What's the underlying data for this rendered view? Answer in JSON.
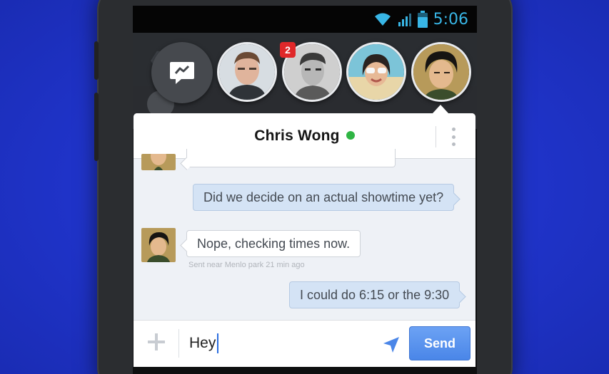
{
  "status_bar": {
    "time": "5:06",
    "wifi_icon": "wifi-icon",
    "signal_icon": "signal-icon",
    "battery_icon": "battery-icon"
  },
  "chat_heads": [
    {
      "name": "messenger",
      "icon": "messenger-icon"
    },
    {
      "name": "contact-1"
    },
    {
      "name": "contact-2",
      "badge": "2"
    },
    {
      "name": "contact-3"
    },
    {
      "name": "chris-wong",
      "active": true
    }
  ],
  "chat": {
    "contact_name": "Chris Wong",
    "online_color": "#2fb544",
    "messages": [
      {
        "direction": "out",
        "text": "Did we decide on an actual showtime yet?"
      },
      {
        "direction": "in",
        "text": "Nope, checking times now.",
        "meta": "Sent near Menlo park 21 min ago"
      },
      {
        "direction": "out",
        "text": "I could do 6:15 or the 9:30"
      }
    ]
  },
  "composer": {
    "value": "Hey",
    "send_label": "Send",
    "accent": "#4a86e8"
  }
}
